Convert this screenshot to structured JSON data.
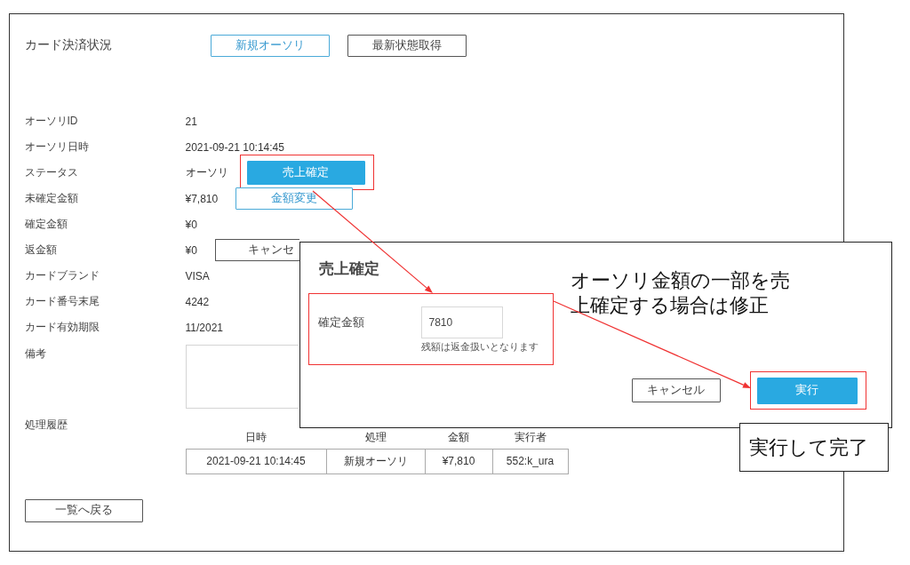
{
  "page": {
    "title": "カード決済状況",
    "header_buttons": [
      {
        "label": "新規オーソリ",
        "kind": "primary-outline",
        "highlighted": false
      },
      {
        "label": "最新状態取得",
        "kind": "outline",
        "highlighted": false
      }
    ]
  },
  "details": [
    {
      "kind": "text",
      "label": "オーソリID",
      "value": "21"
    },
    {
      "kind": "text",
      "label": "オーソリ日時",
      "value": "2021-09-21 10:14:45"
    },
    {
      "kind": "text",
      "label": "ステータス",
      "value": "オーソリ",
      "button": {
        "label": "売上確定",
        "kind": "primary",
        "highlighted": true
      }
    },
    {
      "kind": "text",
      "label": "未確定金額",
      "value": "¥7,810",
      "button": {
        "label": "金額変更",
        "kind": "primary-outline",
        "highlighted": false
      }
    },
    {
      "kind": "text",
      "label": "確定金額",
      "value": "¥0"
    },
    {
      "kind": "text",
      "label": "返金額",
      "value": "¥0",
      "button": {
        "label": "キャンセ",
        "kind": "outline",
        "highlighted": false
      }
    },
    {
      "kind": "text",
      "label": "カードブランド",
      "value": "VISA"
    },
    {
      "kind": "text",
      "label": "カード番号末尾",
      "value": "4242"
    },
    {
      "kind": "text",
      "label": "カード有効期限",
      "value": "11/2021"
    },
    {
      "kind": "textarea",
      "label": "備考"
    }
  ],
  "history": {
    "label": "処理履歴",
    "columns": [
      "日時",
      "処理",
      "金額",
      "実行者"
    ],
    "rows": [
      [
        "2021-09-21 10:14:45",
        "新規オーソリ",
        "¥7,810",
        "552:k_ura"
      ]
    ]
  },
  "back_button": "一覧へ戻る",
  "dialog": {
    "title": "売上確定",
    "field": {
      "label": "確定金額",
      "value": "7810",
      "hint": "残額は返金扱いとなります",
      "highlighted": true
    },
    "buttons": [
      {
        "label": "キャンセル",
        "kind": "outline",
        "highlighted": false
      },
      {
        "label": "実行",
        "kind": "primary",
        "highlighted": true
      }
    ]
  },
  "annotations": [
    {
      "kind": "note",
      "text": "オーソリ金額の一部を売上確定する場合は修正"
    },
    {
      "kind": "callout",
      "text": "実行して完了"
    }
  ]
}
